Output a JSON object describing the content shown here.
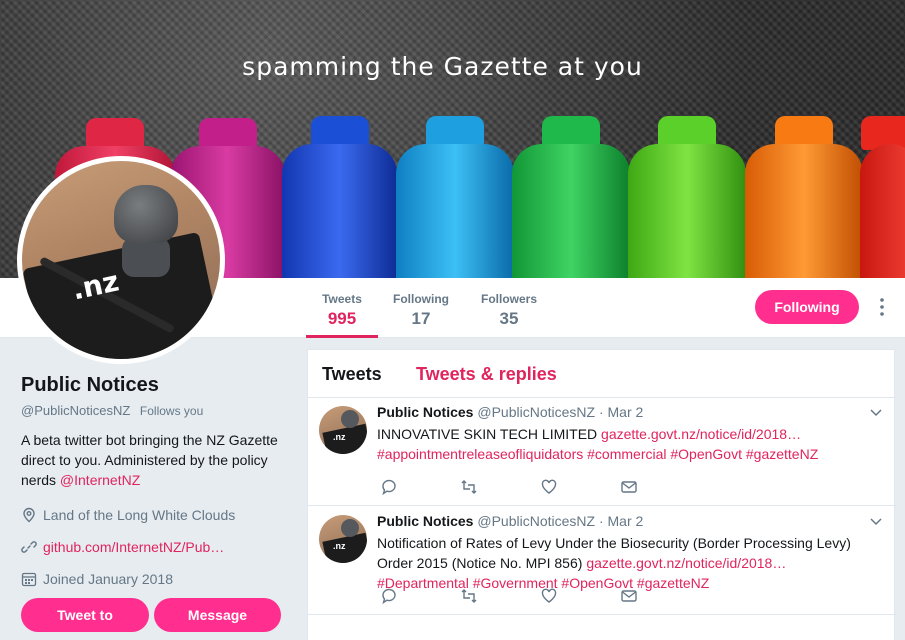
{
  "banner": {
    "text": "spamming the Gazette at you"
  },
  "stats": [
    {
      "label": "Tweets",
      "value": "995"
    },
    {
      "label": "Following",
      "value": "17"
    },
    {
      "label": "Followers",
      "value": "35"
    }
  ],
  "follow_button": "Following",
  "profile": {
    "name": "Public Notices",
    "handle": "@PublicNoticesNZ",
    "follows_you": "Follows you",
    "bio_text": "A beta twitter bot bringing the NZ Gazette direct to you. Administered by the policy nerds ",
    "bio_mention": "@InternetNZ",
    "location": "Land of the Long White Clouds",
    "website": "github.com/InternetNZ/Pub…",
    "joined": "Joined January 2018",
    "tweet_to": "Tweet to",
    "message": "Message"
  },
  "avatar": {
    "logo_text": ".nz"
  },
  "timeline": {
    "tab_active": "Tweets",
    "tab_other": "Tweets & replies",
    "tweets": [
      {
        "name": "Public Notices",
        "handle": "@PublicNoticesNZ",
        "date": "· Mar 2",
        "text": "INNOVATIVE SKIN TECH LIMITED ",
        "link": "gazette.govt.nz/notice/id/2018…",
        "tags": "#appointmentreleaseofliquidators #commercial #OpenGovt #gazetteNZ"
      },
      {
        "name": "Public Notices",
        "handle": "@PublicNoticesNZ",
        "date": "· Mar 2",
        "text": "Notification of Rates of Levy Under the Biosecurity (Border Processing Levy) Order 2015 (Notice No. MPI 856) ",
        "link": "gazette.govt.nz/notice/id/2018…",
        "tags": "#Departmental #Government #OpenGovt #gazetteNZ"
      }
    ]
  },
  "colors": {
    "accent": "#e0245e",
    "button": "#ff2e8f"
  }
}
